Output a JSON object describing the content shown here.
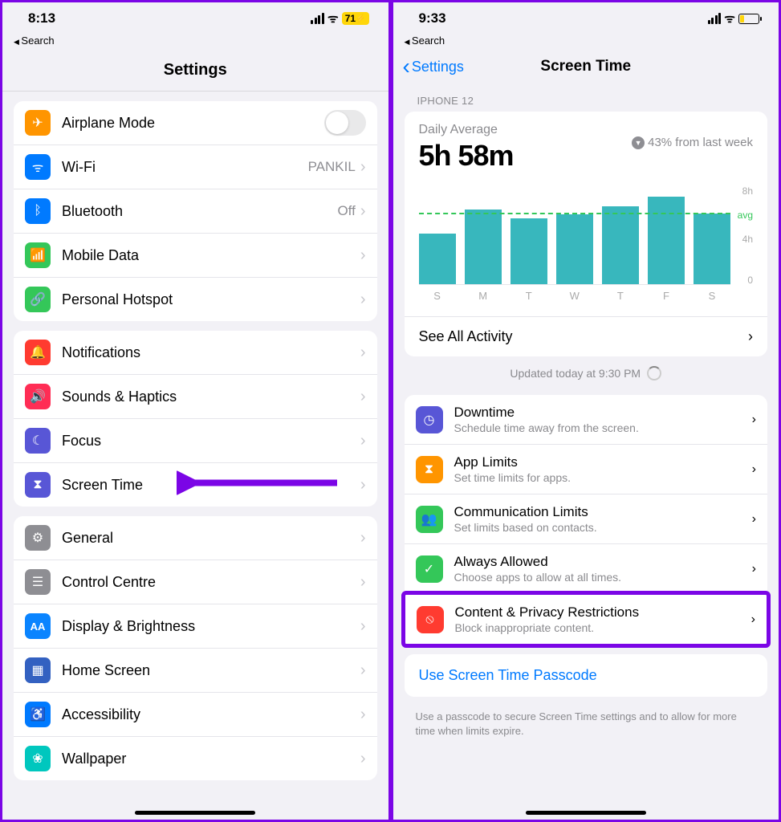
{
  "left": {
    "time": "8:13",
    "battery_pct": "71",
    "breadcrumb": "Search",
    "title": "Settings",
    "groups": [
      [
        {
          "id": "airplane",
          "icon": "airplane-icon",
          "color": "#ff9500",
          "label": "Airplane Mode",
          "toggle": true
        },
        {
          "id": "wifi",
          "icon": "wifi-icon",
          "color": "#007aff",
          "label": "Wi-Fi",
          "value": "PANKIL"
        },
        {
          "id": "bluetooth",
          "icon": "bluetooth-icon",
          "color": "#007aff",
          "label": "Bluetooth",
          "value": "Off"
        },
        {
          "id": "mobile-data",
          "icon": "antenna-icon",
          "color": "#34c759",
          "label": "Mobile Data"
        },
        {
          "id": "hotspot",
          "icon": "link-icon",
          "color": "#34c759",
          "label": "Personal Hotspot"
        }
      ],
      [
        {
          "id": "notifications",
          "icon": "bell-icon",
          "color": "#ff3b30",
          "label": "Notifications"
        },
        {
          "id": "sounds",
          "icon": "speaker-icon",
          "color": "#ff2d55",
          "label": "Sounds & Haptics"
        },
        {
          "id": "focus",
          "icon": "moon-icon",
          "color": "#5856d6",
          "label": "Focus"
        },
        {
          "id": "screen-time",
          "icon": "hourglass-icon",
          "color": "#5856d6",
          "label": "Screen Time",
          "arrow": true
        }
      ],
      [
        {
          "id": "general",
          "icon": "gear-icon",
          "color": "#8e8e93",
          "label": "General"
        },
        {
          "id": "control-centre",
          "icon": "switches-icon",
          "color": "#8e8e93",
          "label": "Control Centre"
        },
        {
          "id": "display",
          "icon": "aa-icon",
          "color": "#0a84ff",
          "label": "Display & Brightness"
        },
        {
          "id": "home-screen",
          "icon": "grid-icon",
          "color": "#3361c1",
          "label": "Home Screen"
        },
        {
          "id": "accessibility",
          "icon": "person-icon",
          "color": "#007aff",
          "label": "Accessibility"
        },
        {
          "id": "wallpaper",
          "icon": "flower-icon",
          "color": "#00c7be",
          "label": "Wallpaper"
        }
      ]
    ]
  },
  "right": {
    "time": "9:33",
    "breadcrumb": "Search",
    "back": "Settings",
    "title": "Screen Time",
    "device": "iPhone 12",
    "daily_avg_label": "Daily Average",
    "daily_avg_value": "5h 58m",
    "delta": "43% from last week",
    "see_all": "See All Activity",
    "updated": "Updated today at 9:30 PM",
    "items": [
      {
        "id": "downtime",
        "icon": "clock-icon",
        "color": "#5856d6",
        "title": "Downtime",
        "sub": "Schedule time away from the screen."
      },
      {
        "id": "app-limits",
        "icon": "hourglass-icon",
        "color": "#ff9500",
        "title": "App Limits",
        "sub": "Set time limits for apps."
      },
      {
        "id": "comm-limits",
        "icon": "people-icon",
        "color": "#34c759",
        "title": "Communication Limits",
        "sub": "Set limits based on contacts."
      },
      {
        "id": "always-allowed",
        "icon": "check-icon",
        "color": "#34c759",
        "title": "Always Allowed",
        "sub": "Choose apps to allow at all times."
      },
      {
        "id": "content-privacy",
        "icon": "no-icon",
        "color": "#ff3b30",
        "title": "Content & Privacy Restrictions",
        "sub": "Block inappropriate content.",
        "highlight": true
      }
    ],
    "passcode_link": "Use Screen Time Passcode",
    "passcode_note": "Use a passcode to secure Screen Time settings and to allow for more time when limits expire."
  },
  "chart_data": {
    "type": "bar",
    "categories": [
      "S",
      "M",
      "T",
      "W",
      "T",
      "F",
      "S"
    ],
    "values": [
      4.2,
      6.2,
      5.5,
      5.8,
      6.5,
      7.3,
      5.9
    ],
    "avg": 5.97,
    "ylim": [
      0,
      8
    ],
    "yticks": [
      0,
      4,
      8
    ],
    "ylabels": [
      "0",
      "4h",
      "8h"
    ],
    "avg_label": "avg",
    "title": "Daily Average"
  },
  "icons": {
    "airplane-icon": "✈",
    "wifi-icon": "ᯤ",
    "bluetooth-icon": "ᛒ",
    "antenna-icon": "📶",
    "link-icon": "🔗",
    "bell-icon": "🔔",
    "speaker-icon": "🔊",
    "moon-icon": "☾",
    "hourglass-icon": "⧗",
    "gear-icon": "⚙",
    "switches-icon": "☰",
    "aa-icon": "AA",
    "grid-icon": "▦",
    "person-icon": "♿",
    "flower-icon": "❀",
    "clock-icon": "◷",
    "people-icon": "👥",
    "check-icon": "✓",
    "no-icon": "⦸",
    "chevron-icon": "›",
    "back-icon": "‹",
    "down-icon": "▼"
  }
}
